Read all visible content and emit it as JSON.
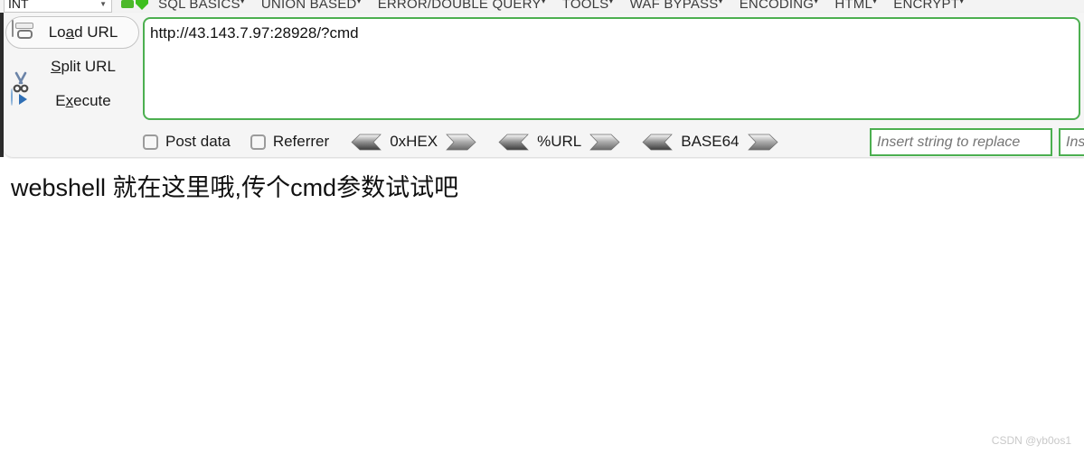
{
  "menubar": {
    "type_select": {
      "value": "INT",
      "caret": "chevron-down-icon"
    },
    "icons": [
      "green-minimize-icon",
      "green-download-icon"
    ],
    "items": [
      {
        "label": "SQL BASICS",
        "has_submenu": true
      },
      {
        "label": "UNION BASED",
        "has_submenu": true
      },
      {
        "label": "ERROR/DOUBLE QUERY",
        "has_submenu": true
      },
      {
        "label": "TOOLS",
        "has_submenu": true
      },
      {
        "label": "WAF BYPASS",
        "has_submenu": true
      },
      {
        "label": "ENCODING",
        "has_submenu": true
      },
      {
        "label": "HTML",
        "has_submenu": true
      },
      {
        "label": "ENCRYPT",
        "has_submenu": true
      }
    ]
  },
  "hackbar": {
    "buttons": [
      {
        "label_pre": "Lo",
        "label_key": "a",
        "label_post": "d URL",
        "icon": "drive-icon",
        "active": true
      },
      {
        "label_pre": "",
        "label_key": "S",
        "label_post": "plit URL",
        "icon": "scissors-icon",
        "active": false
      },
      {
        "label_pre": "E",
        "label_key": "x",
        "label_post": "ecute",
        "icon": "play-icon",
        "active": false
      }
    ],
    "url_value": "http://43.143.7.97:28928/?cmd",
    "checkboxes": [
      {
        "label": "Post data",
        "checked": false
      },
      {
        "label": "Referrer",
        "checked": false
      }
    ],
    "codecs": [
      {
        "name": "0xHEX"
      },
      {
        "name": "%URL"
      },
      {
        "name": "BASE64"
      }
    ],
    "replace_fields": [
      {
        "placeholder": "Insert string to replace",
        "value": ""
      },
      {
        "placeholder": "Insert string",
        "value": ""
      }
    ],
    "accent_green": "#4caf50"
  },
  "page": {
    "body_text": "webshell 就在这里哦,传个cmd参数试试吧",
    "watermark": "CSDN @yb0os1"
  }
}
